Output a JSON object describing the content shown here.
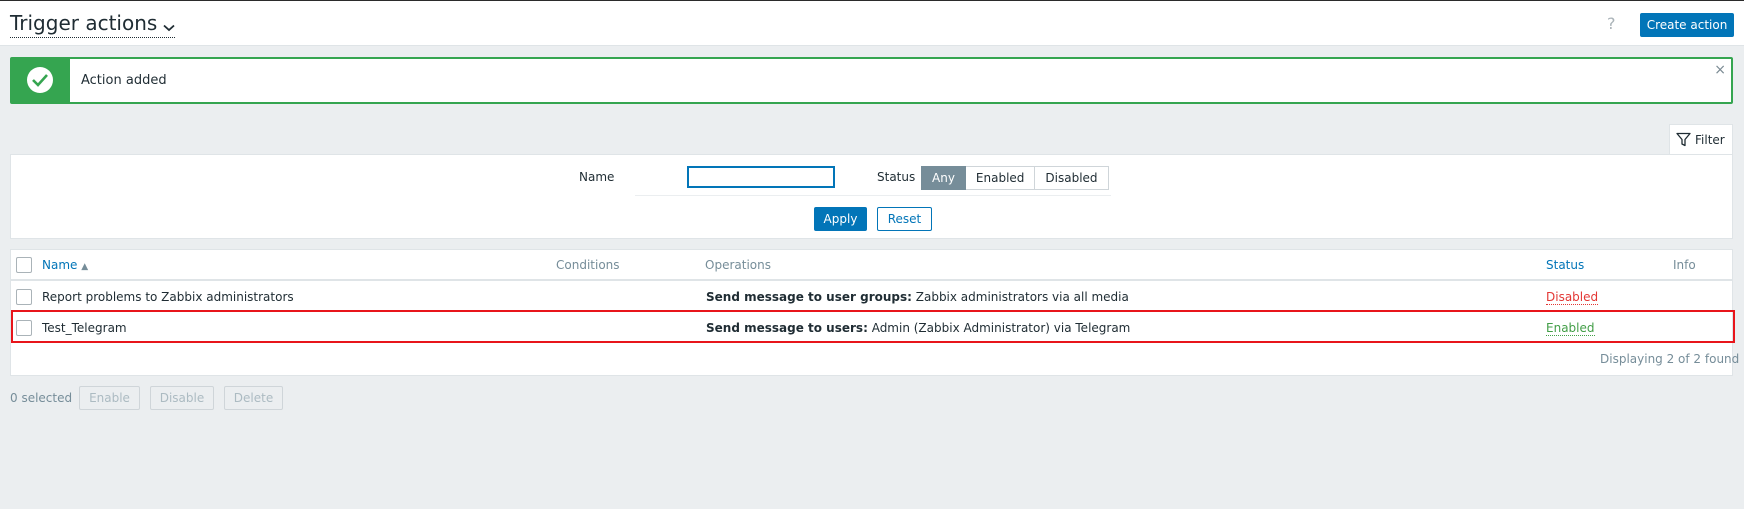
{
  "header": {
    "title": "Trigger actions",
    "help": "?",
    "create_label": "Create action"
  },
  "message": {
    "text": "Action added",
    "close": "×"
  },
  "filter": {
    "tab_label": "Filter",
    "name_label": "Name",
    "name_value": "",
    "status_label": "Status",
    "status_options": [
      "Any",
      "Enabled",
      "Disabled"
    ],
    "status_selected": "Any",
    "apply_label": "Apply",
    "reset_label": "Reset"
  },
  "table": {
    "columns": {
      "name": "Name",
      "conditions": "Conditions",
      "operations": "Operations",
      "status": "Status",
      "info": "Info"
    },
    "sort_indicator": "▲",
    "rows": [
      {
        "name": "Report problems to Zabbix administrators",
        "conditions": "",
        "op_bold": "Send message to user groups:",
        "op_text": " Zabbix administrators via all media",
        "status": "Disabled"
      },
      {
        "name": "Test_Telegram",
        "conditions": "",
        "op_bold": "Send message to users:",
        "op_text": " Admin (Zabbix Administrator) via Telegram",
        "status": "Enabled"
      }
    ],
    "footer": "Displaying 2 of 2 found"
  },
  "mass_actions": {
    "selected": "0 selected",
    "enable": "Enable",
    "disable": "Disable",
    "delete": "Delete"
  },
  "colors": {
    "accent": "#0275b8",
    "success": "#35a550",
    "disabled_status": "#e33734",
    "enabled_status": "#429e47",
    "highlight_box": "#e8151b"
  }
}
